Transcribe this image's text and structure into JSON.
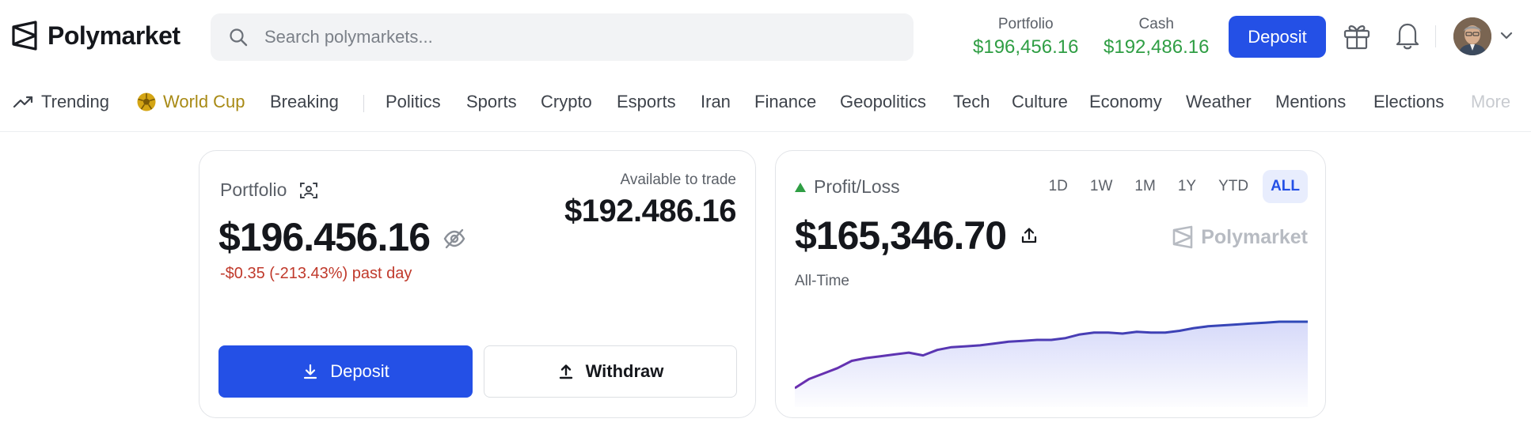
{
  "header": {
    "brand": "Polymarket",
    "search_placeholder": "Search polymarkets...",
    "portfolio_label": "Portfolio",
    "portfolio_value": "$196,456.16",
    "cash_label": "Cash",
    "cash_value": "$192,486.16",
    "deposit_label": "Deposit",
    "icons": [
      "polymarket-logo-icon",
      "search-icon",
      "gift-icon",
      "bell-icon",
      "chevron-down-icon"
    ]
  },
  "nav": {
    "trending": "Trending",
    "world_cup": "World Cup",
    "breaking": "Breaking",
    "categories": [
      "Politics",
      "Sports",
      "Crypto",
      "Esports",
      "Iran",
      "Finance",
      "Geopolitics",
      "Tech",
      "Culture",
      "Economy",
      "Weather",
      "Mentions",
      "Elections",
      "More"
    ]
  },
  "portfolio_card": {
    "title": "Portfolio",
    "value": "$196.456.16",
    "change": "-$0.35 (-213.43%) past day",
    "available_label": "Available to trade",
    "available_value": "$192.486.16",
    "deposit_label": "Deposit",
    "withdraw_label": "Withdraw"
  },
  "pnl_card": {
    "title": "Profit/Loss",
    "value": "$165,346.70",
    "period_label": "All-Time",
    "watermark": "Polymarket",
    "ranges": [
      "1D",
      "1W",
      "1M",
      "1Y",
      "YTD",
      "ALL"
    ],
    "active_range": "ALL"
  },
  "chart_data": {
    "type": "area",
    "y": [
      0,
      10,
      16,
      22,
      30,
      33,
      35,
      37,
      39,
      36,
      42,
      45,
      46,
      47,
      49,
      51,
      52,
      53,
      53,
      55,
      59,
      61,
      61,
      60,
      62,
      61,
      61,
      63,
      66,
      68,
      69,
      70,
      71,
      72,
      73,
      73,
      73
    ]
  },
  "colors": {
    "accent": "#2450e6",
    "positive": "#2f9e44",
    "negative": "#c0392b"
  }
}
